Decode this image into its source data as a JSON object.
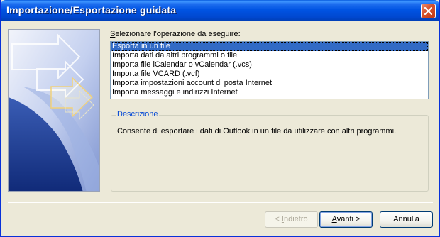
{
  "window": {
    "title": "Importazione/Esportazione guidata"
  },
  "prompt": {
    "text": "Selezionare l'operazione da eseguire:"
  },
  "operations": {
    "items": [
      {
        "label": "Esporta in un file",
        "selected": true
      },
      {
        "label": "Importa dati da altri programmi o file",
        "selected": false
      },
      {
        "label": "Importa file iCalendar o vCalendar (.vcs)",
        "selected": false
      },
      {
        "label": "Importa file VCARD (.vcf)",
        "selected": false
      },
      {
        "label": "Importa impostazioni account di posta Internet",
        "selected": false
      },
      {
        "label": "Importa messaggi e indirizzi Internet",
        "selected": false
      }
    ]
  },
  "description": {
    "legend": "Descrizione",
    "text": "Consente di esportare i dati di Outlook in un file da utilizzare con altri programmi."
  },
  "buttons": {
    "back_prefix": "< ",
    "back_underline": "I",
    "back_rest": "ndietro",
    "next_underline": "A",
    "next_rest": "vanti >",
    "cancel": "Annulla"
  },
  "colors": {
    "title_bar": "#0054e3",
    "selection": "#316ac5",
    "legend": "#0046d5",
    "dialog_bg": "#ece9d8"
  },
  "icons": {
    "close": "close-icon",
    "art": "wizard-arrows-graphic"
  }
}
